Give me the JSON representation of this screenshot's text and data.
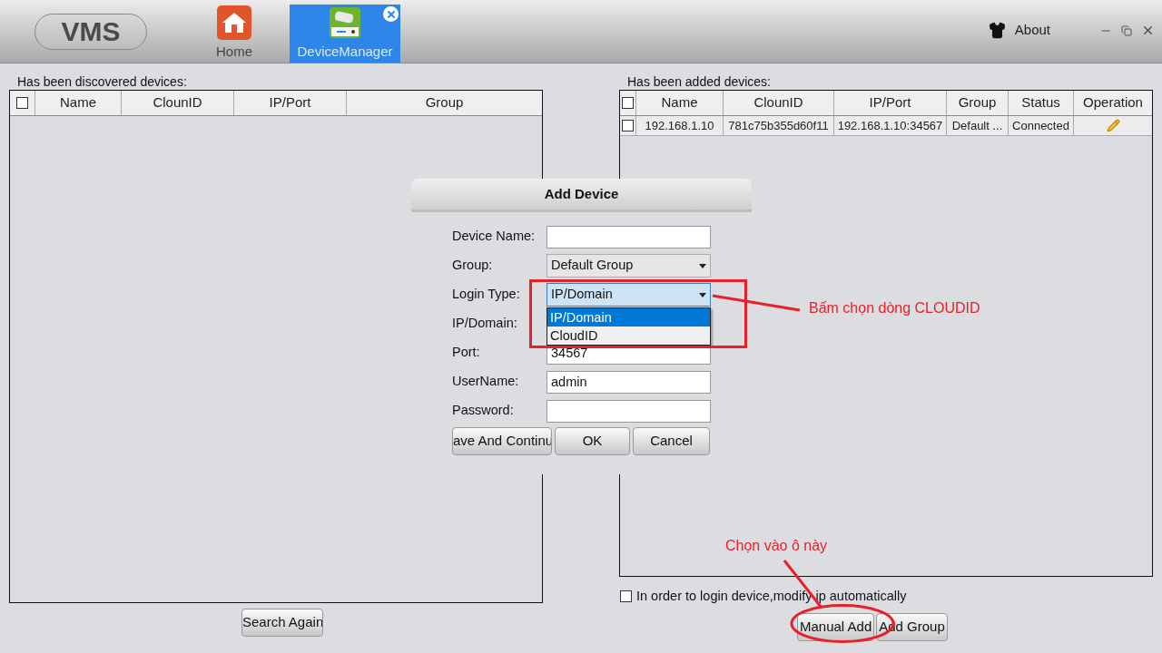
{
  "window": {
    "logo": "VMS",
    "about": "About",
    "tabs": [
      {
        "label": "Home",
        "kind": "home",
        "selected": false
      },
      {
        "label": "DeviceManager",
        "kind": "device",
        "selected": true
      }
    ]
  },
  "discovered": {
    "title": "Has been discovered devices:",
    "columns": [
      "Name",
      "ClounID",
      "IP/Port",
      "Group"
    ],
    "select_all": {
      "checked": false
    },
    "button": "Search Again"
  },
  "added": {
    "title": "Has been added devices:",
    "columns": [
      "Name",
      "ClounID",
      "IP/Port",
      "Group",
      "Status",
      "Operation"
    ],
    "select_all": {
      "checked": false
    },
    "rows": [
      {
        "checked": false,
        "cells": [
          "192.168.1.10",
          "781c75b355d60f11",
          "192.168.1.10:34567",
          "Default ...",
          "Connected"
        ]
      }
    ],
    "auto_ip": {
      "label": "In order to login device,modify ip automatically",
      "checked": false
    },
    "buttons": [
      "Manual Add",
      "Add Group"
    ]
  },
  "dialog": {
    "title": "Add Device",
    "fields": [
      {
        "label": "Device Name:",
        "kind": "text"
      },
      {
        "label": "Group:",
        "kind": "select",
        "value": "Default Group"
      },
      {
        "label": "Login Type:",
        "kind": "select",
        "value": "IP/Domain",
        "expanded": true,
        "options": [
          {
            "label": "IP/Domain",
            "selected": true
          },
          {
            "label": "CloudID",
            "selected": false
          }
        ]
      },
      {
        "label": "IP/Domain:",
        "kind": "text"
      },
      {
        "label": "Port:",
        "kind": "text",
        "value": "34567"
      },
      {
        "label": "UserName:",
        "kind": "text",
        "value": "admin"
      },
      {
        "label": "Password:",
        "kind": "text"
      }
    ],
    "buttons": [
      "ave And Continu",
      "OK",
      "Cancel"
    ]
  },
  "annotations": [
    {
      "kind": "box",
      "text": "Bấm chọn dòng CLOUDID"
    },
    {
      "kind": "ellipse",
      "text": "Chọn vào ô này"
    }
  ]
}
